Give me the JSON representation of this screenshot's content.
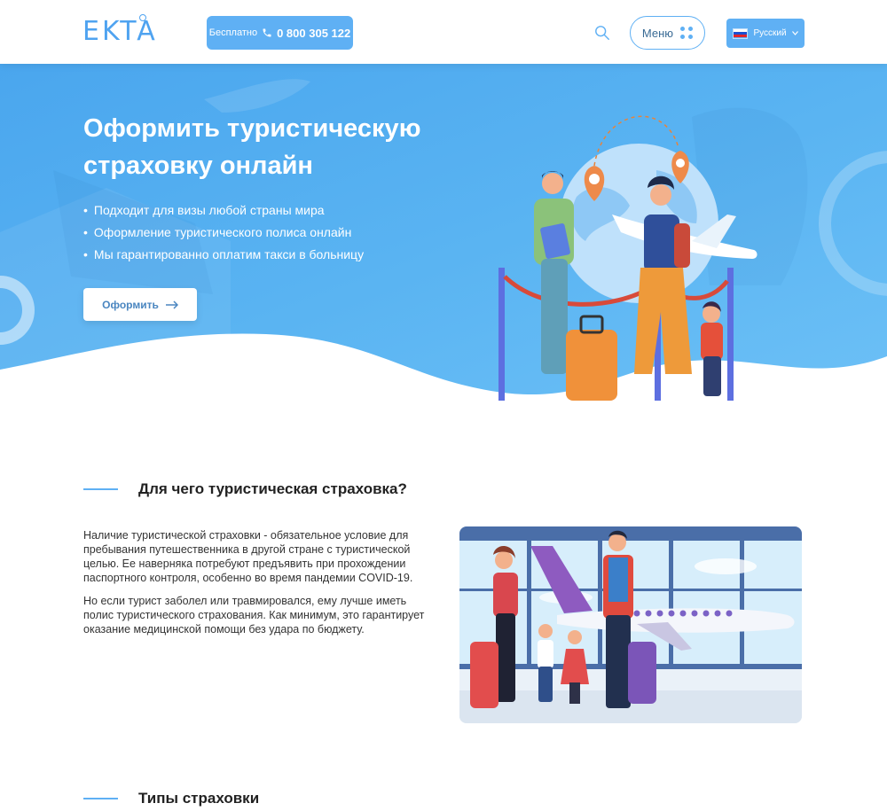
{
  "header": {
    "logo_text": "EKTA",
    "phone_label": "Бесплатно",
    "phone_number": "0 800 305 122",
    "menu_label": "Меню",
    "language_label": "Русский"
  },
  "hero": {
    "title": "Оформить туристическую страховку онлайн",
    "bullets": [
      "Подходит для визы любой страны мира",
      "Оформление туристического полиса онлайн",
      "Мы гарантированно оплатим такси в больницу"
    ],
    "cta_label": "Оформить"
  },
  "why_section": {
    "title": "Для чего туристическая страховка?",
    "paragraphs": [
      "Наличие туристической страховки - обязательное условие для пребывания путешественника в другой стране с туристической целью. Ее наверняка потребуют предъявить при прохождении паспортного контроля, особенно во время пандемии COVID-19.",
      "Но если турист заболел или травмировался, ему лучше иметь полис туристического страхования. Как минимум, это гарантирует оказание медицинской помощи без удара по бюджету."
    ]
  },
  "types_section": {
    "title": "Типы страховки"
  },
  "colors": {
    "accent": "#5fb0f4",
    "hero_bg": "#5ab4f2",
    "text_dark": "#222222"
  },
  "icons": {
    "phone": "phone-icon",
    "search": "search-icon",
    "menu": "dots-grid-icon",
    "language": "russian-flag-icon",
    "cta": "arrow-right-icon"
  }
}
